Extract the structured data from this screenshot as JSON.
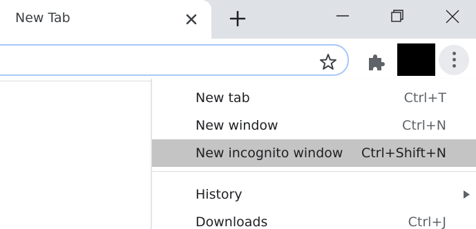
{
  "tab": {
    "title": "New Tab"
  },
  "icons": {
    "tab_close": "close-icon",
    "new_tab": "plus-icon",
    "minimize": "minimize-icon",
    "maximize": "restore-icon",
    "close_window": "close-icon",
    "bookmark": "star-icon",
    "extensions": "puzzle-icon",
    "menu": "more-vertical-icon",
    "submenu": "caret-right-icon"
  },
  "menu": {
    "items": [
      {
        "label": "New tab",
        "shortcut": "Ctrl+T"
      },
      {
        "label": "New window",
        "shortcut": "Ctrl+N"
      },
      {
        "label": "New incognito window",
        "shortcut": "Ctrl+Shift+N"
      },
      {
        "label": "History",
        "shortcut": ""
      },
      {
        "label": "Downloads",
        "shortcut": "Ctrl+J"
      }
    ],
    "highlighted_index": 2
  },
  "colors": {
    "tabstrip": "#dee1e6",
    "highlight": "#c4c4c4",
    "omnibox_border": "#a8c7fa"
  }
}
